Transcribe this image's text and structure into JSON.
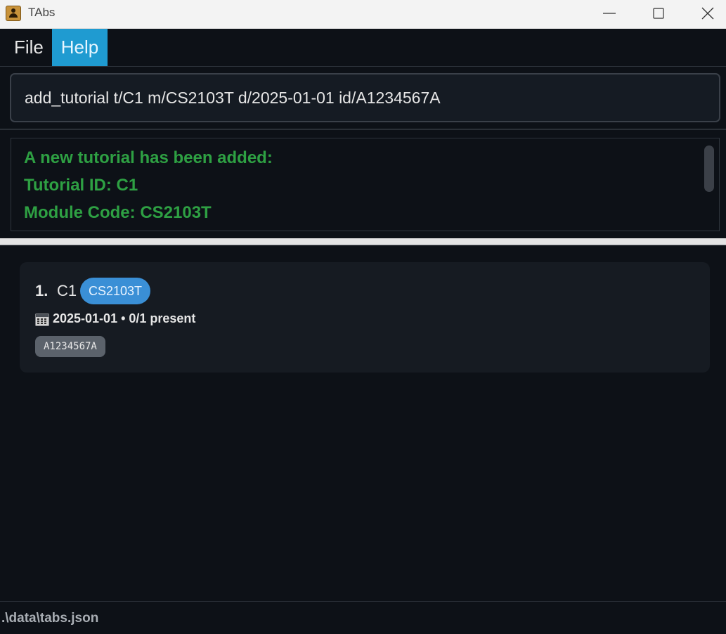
{
  "window": {
    "title": "TAbs"
  },
  "menu": {
    "items": [
      {
        "label": "File"
      },
      {
        "label": "Help"
      }
    ]
  },
  "command": {
    "value": "add_tutorial t/C1 m/CS2103T d/2025-01-01 id/A1234567A"
  },
  "result": {
    "lines": [
      "A new tutorial has been added:",
      "Tutorial ID: C1",
      "Module Code: CS2103T"
    ]
  },
  "tutorials": [
    {
      "index": "1.",
      "id": "C1",
      "module": "CS2103T",
      "date_attendance": "2025-01-01 • 0/1 present",
      "students": [
        "A1234567A"
      ]
    }
  ],
  "status": {
    "path": ".\\data\\tabs.json"
  },
  "colors": {
    "accent": "#1f9bd1",
    "success": "#2ea043",
    "module_badge": "#3a8fd6"
  }
}
